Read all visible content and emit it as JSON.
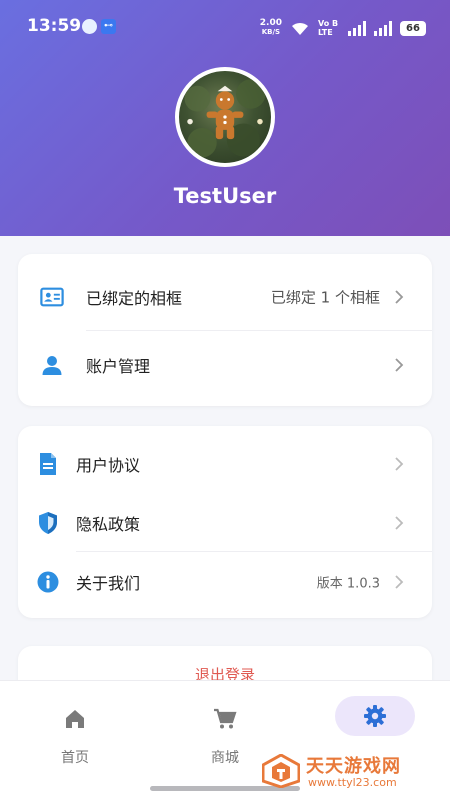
{
  "status_bar": {
    "time": "13:59",
    "net_speed_value": "2.00",
    "net_speed_unit": "KB/S",
    "network_label": "Vo B LTE",
    "battery": "66",
    "vpn_key_icon": "key-icon"
  },
  "profile": {
    "username": "TestUser",
    "avatar_icon": "gingerbread-avatar"
  },
  "card_account": {
    "rows": [
      {
        "label": "已绑定的相框",
        "value": "已绑定 1 个相框",
        "icon": "id-card-icon"
      },
      {
        "label": "账户管理",
        "value": "",
        "icon": "person-icon"
      }
    ]
  },
  "card_info": {
    "rows": [
      {
        "label": "用户协议",
        "value": "",
        "icon": "document-icon"
      },
      {
        "label": "隐私政策",
        "value": "",
        "icon": "shield-icon"
      },
      {
        "label": "关于我们",
        "value": "版本 1.0.3",
        "icon": "info-icon"
      }
    ]
  },
  "logout": {
    "label": "退出登录"
  },
  "bottom_nav": {
    "items": [
      {
        "label": "首页",
        "icon": "home-icon"
      },
      {
        "label": "商城",
        "icon": "cart-icon"
      },
      {
        "label": "",
        "icon": "gear-icon",
        "active": true
      }
    ]
  },
  "watermark": {
    "title": "天天游戏网",
    "url": "www.ttyl23.com"
  },
  "colors": {
    "header_gradient_start": "#6a6fe0",
    "header_gradient_end": "#7d4fb8",
    "icon_blue": "#2d8ee0",
    "logout_red": "#e05a52",
    "active_nav_bg": "#ece6fb",
    "active_nav_icon": "#2d6fd6"
  }
}
